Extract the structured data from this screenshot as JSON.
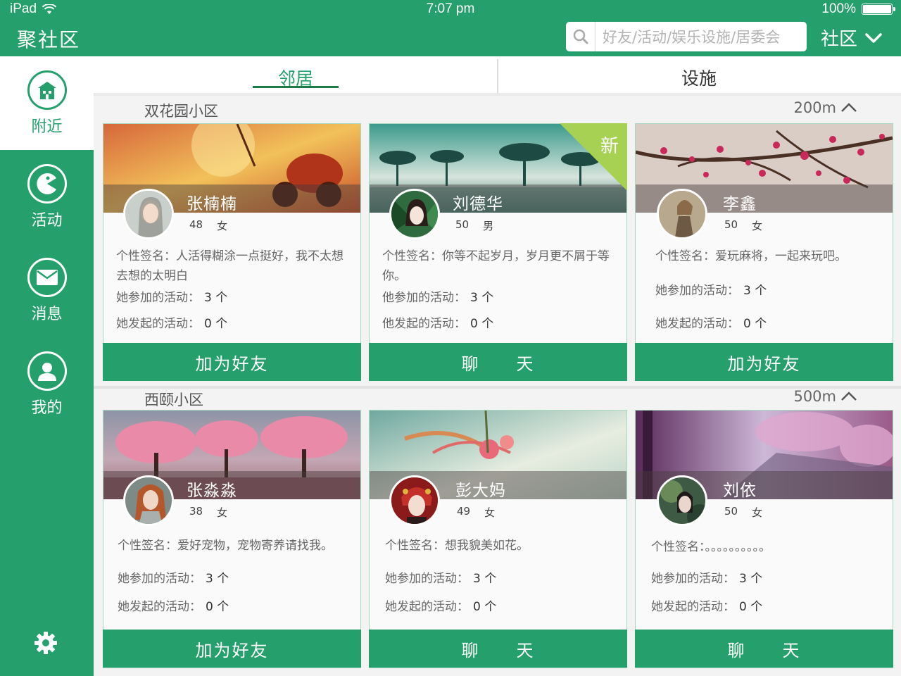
{
  "status_bar": {
    "carrier": "iPad",
    "time": "7:07 pm",
    "battery": "100%"
  },
  "header": {
    "app_title": "聚社区",
    "search_placeholder": "好友/活动/娱乐设施/居委会",
    "community_label": "社区"
  },
  "sidebar": {
    "items": [
      {
        "label": "附近",
        "icon": "house-icon",
        "active": true
      },
      {
        "label": "活动",
        "icon": "pacman-icon",
        "active": false
      },
      {
        "label": "消息",
        "icon": "envelope-icon",
        "active": false
      },
      {
        "label": "我的",
        "icon": "user-icon",
        "active": false
      }
    ],
    "settings_icon": "gear-icon"
  },
  "tabs": [
    {
      "label": "邻居",
      "active": true
    },
    {
      "label": "设施",
      "active": false
    }
  ],
  "sections": [
    {
      "name": "双花园小区",
      "distance": "200m",
      "cards": [
        {
          "name": "张楠楠",
          "age": "48",
          "gender": "女",
          "signature_label": "个性签名：",
          "signature": "人活得糊涂一点挺好，我不太想去想的太明白",
          "joined_label": "她参加的活动：",
          "joined": "3 个",
          "created_label": "她发起的活动：",
          "created": "0 个",
          "button": "加为好友",
          "is_new": false
        },
        {
          "name": "刘德华",
          "age": "50",
          "gender": "男",
          "signature_label": "个性签名：",
          "signature": "你等不起岁月，岁月更不屑于等你。",
          "joined_label": "他参加的活动：",
          "joined": "3 个",
          "created_label": "他发起的活动：",
          "created": "0 个",
          "button": "聊　　天",
          "is_new": true,
          "new_badge": "新"
        },
        {
          "name": "李鑫",
          "age": "50",
          "gender": "女",
          "signature_label": "个性签名：",
          "signature": "爱玩麻将，一起来玩吧。",
          "joined_label": "她参加的活动：",
          "joined": "3 个",
          "created_label": "她发起的活动：",
          "created": "0 个",
          "button": "加为好友",
          "is_new": false
        }
      ]
    },
    {
      "name": "西颐小区",
      "distance": "500m",
      "cards": [
        {
          "name": "张淼淼",
          "age": "38",
          "gender": "女",
          "signature_label": "个性签名：",
          "signature": "爱好宠物，宠物寄养请找我。",
          "joined_label": "她参加的活动：",
          "joined": "3 个",
          "created_label": "她发起的活动：",
          "created": "0 个",
          "button": "加为好友",
          "is_new": false
        },
        {
          "name": "彭大妈",
          "age": "49",
          "gender": "女",
          "signature_label": "个性签名：",
          "signature": "想我貌美如花。",
          "joined_label": "她参加的活动：",
          "joined": "3 个",
          "created_label": "她发起的活动：",
          "created": "0 个",
          "button": "聊　　天",
          "is_new": false
        },
        {
          "name": "刘依",
          "age": "50",
          "gender": "女",
          "signature_label": "个性签名：",
          "signature": "。。。。。。。。。。",
          "joined_label": "她参加的活动：",
          "joined": "3 个",
          "created_label": "她发起的活动：",
          "created": "0 个",
          "button": "聊　　天",
          "is_new": false
        }
      ]
    }
  ],
  "colors": {
    "primary": "#25a06c",
    "new_badge": "#a7d152"
  }
}
